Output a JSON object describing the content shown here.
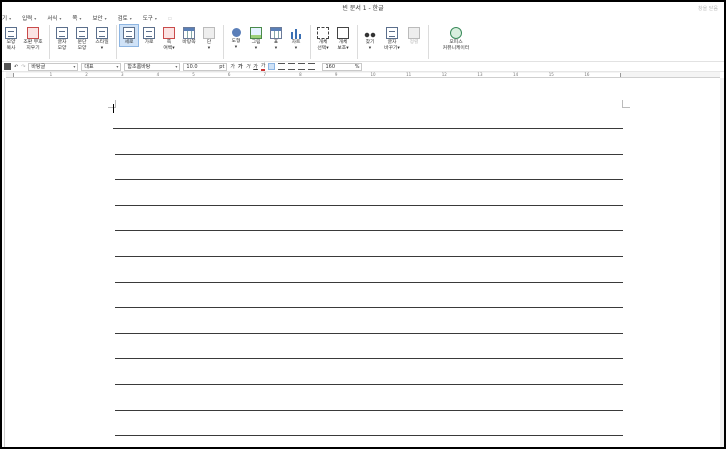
{
  "window": {
    "title": "빈 문서 1 - 한글",
    "right_label": "창을 닫음"
  },
  "menu": [
    {
      "label": "기",
      "caret": true
    },
    {
      "label": "입력",
      "caret": true
    },
    {
      "label": "서식",
      "caret": true
    },
    {
      "label": "쪽",
      "caret": true
    },
    {
      "label": "보안",
      "caret": true
    },
    {
      "label": "검토",
      "caret": true
    },
    {
      "label": "도구",
      "caret": true
    }
  ],
  "menu_extra_glyph": "▫",
  "ribbon": [
    {
      "name": "copy-format",
      "l1": "모양",
      "l2": "복사",
      "icon": "doc",
      "w": ""
    },
    {
      "name": "clear-format",
      "l1": "조판 부호",
      "l2": "지우기",
      "icon": "red",
      "w": "w22"
    },
    {
      "name": "char-shape",
      "l1": "글자",
      "l2": "모양",
      "icon": "doc",
      "w": ""
    },
    {
      "name": "para-shape",
      "l1": "문단",
      "l2": "모양",
      "icon": "doc",
      "w": ""
    },
    {
      "name": "style",
      "l1": "스타일",
      "l2": "▾",
      "icon": "doc",
      "w": ""
    },
    {
      "name": "vertical",
      "l1": "세로",
      "l2": "",
      "icon": "doc",
      "w": "",
      "active": true
    },
    {
      "name": "horizontal",
      "l1": "가로",
      "l2": "",
      "icon": "doc",
      "w": ""
    },
    {
      "name": "margin",
      "l1": "쪽",
      "l2": "여백▾",
      "icon": "red",
      "w": ""
    },
    {
      "name": "background",
      "l1": "바탕쪽",
      "l2": "",
      "icon": "grid",
      "w": ""
    },
    {
      "name": "columns",
      "l1": "단",
      "l2": "▾",
      "icon": "gray",
      "w": ""
    },
    {
      "name": "shape",
      "l1": "도형",
      "l2": "▾",
      "icon": "shape",
      "w": ""
    },
    {
      "name": "picture",
      "l1": "그림",
      "l2": "▾",
      "icon": "pic",
      "w": ""
    },
    {
      "name": "table",
      "l1": "표",
      "l2": "▾",
      "icon": "grid",
      "w": ""
    },
    {
      "name": "chart",
      "l1": "차트",
      "l2": "▾",
      "icon": "bars",
      "w": ""
    },
    {
      "name": "select-object",
      "l1": "개체",
      "l2": "선택▾",
      "icon": "dotted",
      "w": ""
    },
    {
      "name": "protect-object",
      "l1": "개체",
      "l2": "보호▾",
      "icon": "lock",
      "w": ""
    },
    {
      "name": "find",
      "l1": "찾기",
      "l2": "▾",
      "icon": "binoc",
      "w": ""
    },
    {
      "name": "replace",
      "l1": "글자",
      "l2": "바꾸기▾",
      "icon": "doc",
      "w": "w22"
    },
    {
      "name": "sort",
      "l1": "정렬",
      "l2": "",
      "icon": "gray",
      "w": "",
      "disabled": true
    },
    {
      "name": "office-community",
      "l1": "오피스",
      "l2": "커뮤니케이터",
      "icon": "green",
      "w": "w44"
    }
  ],
  "fmt": {
    "style_value": "바탕글",
    "lang_value": "대표",
    "font_value": "함초롬바탕",
    "size_value": "10.0",
    "size_unit": "pt",
    "char_gap": "가",
    "bold": "가",
    "italic": "가",
    "underline": "가",
    "color": "가",
    "zoom_value": "160",
    "zoom_unit": "%"
  },
  "ruler_numbers": [
    "1",
    "2",
    "3",
    "4",
    "5",
    "6",
    "7",
    "8",
    "9",
    "10",
    "11",
    "12",
    "13",
    "14",
    "15",
    "16"
  ],
  "document": {
    "ruled_lines": 13
  }
}
